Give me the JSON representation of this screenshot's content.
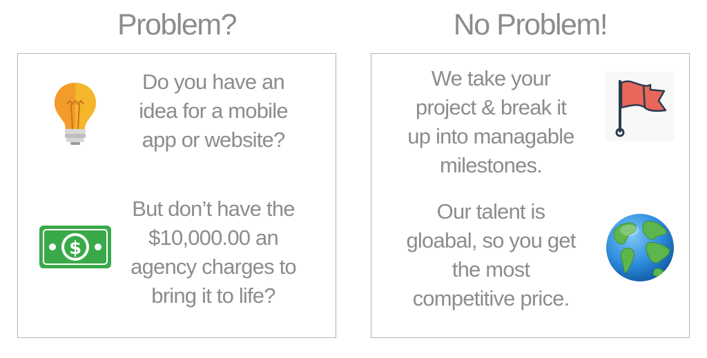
{
  "left": {
    "title": "Problem?",
    "items": [
      {
        "icon": "lightbulb-icon",
        "lines": [
          "Do you have an",
          "idea for a mobile",
          "app or website?"
        ]
      },
      {
        "icon": "dollar-bill-icon",
        "lines": [
          "But don’t have the",
          "$10,000.00 an",
          "agency charges to",
          "bring it to life?"
        ]
      }
    ]
  },
  "right": {
    "title": "No Problem!",
    "items": [
      {
        "icon": "flag-icon",
        "lines": [
          "We take your",
          "project & break it",
          "up into managable",
          "milestones."
        ]
      },
      {
        "icon": "globe-icon",
        "lines": [
          "Our talent is",
          "gloabal, so you get",
          "the most",
          "competitive price."
        ]
      }
    ]
  },
  "colors": {
    "text": "#8c8c8c",
    "border": "#b3b3b3",
    "bulb_yellow": "#f4b62a",
    "bill_green": "#3aa94a",
    "flag_red": "#e8665a",
    "globe_blue": "#2e8ede",
    "globe_green": "#5cb54d"
  }
}
